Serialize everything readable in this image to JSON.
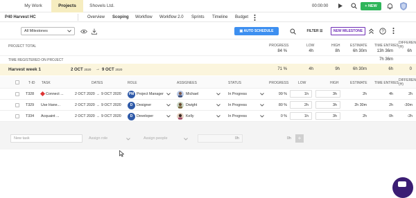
{
  "topbar": {
    "tabs": [
      "My Work",
      "Projects",
      "Shovels Ltd."
    ],
    "timer": "00:00:00",
    "new_label": "NEW"
  },
  "subbar": {
    "project": "P40 Harvest HC",
    "tabs": [
      "Overview",
      "Scoping",
      "Workflow",
      "Workflow 2.0",
      "Sprints",
      "Timeline",
      "Budget"
    ]
  },
  "toolbar": {
    "milestone_select": "All Milestones",
    "auto_schedule": "AUTO SCHEDULE",
    "filter": "FILTER",
    "new_milestone": "NEW MILESTONE"
  },
  "summary_headers": {
    "progress": "PROGRESS",
    "low": "LOW",
    "high": "HIGH",
    "estimate": "ESTIMATE",
    "time_entries": "TIME ENTRIES",
    "difference": "DIFFERENCE (H)"
  },
  "project_total": {
    "label": "PROJECT TOTAL",
    "progress": "84 %",
    "low": "4h",
    "high": "8h",
    "estimate": "6h 30m",
    "time_entries": "13h 36m",
    "difference": "6h"
  },
  "time_registered": {
    "label": "TIME REGISTERED ON PROJECT",
    "value": "7h 36m"
  },
  "milestone": {
    "name": "Harvest week 1",
    "start": "2 OCT",
    "start_year": "2020",
    "end": "9 OCT",
    "end_year": "2020",
    "progress": "71 %",
    "low": "4h",
    "high": "9h",
    "estimate": "6h 30m",
    "time_entries": "6h",
    "difference": "0"
  },
  "task_headers": {
    "id": "T-ID",
    "task": "TASK",
    "dates": "DATES",
    "role": "ROLE",
    "assignees": "ASSIGNEES",
    "status": "STATUS",
    "progress": "PROGRESS",
    "low": "LOW",
    "high": "HIGH",
    "estimate": "ESTIMATE",
    "time_entries": "TIME ENTRIES",
    "difference": "DIFFERENCE (H)"
  },
  "tasks": [
    {
      "id": "T328",
      "name": "Connect ...",
      "start": "2 OCT 2020",
      "end": "9 OCT 2020",
      "role": "Project Manager",
      "role_abbr": "PM",
      "assignee": "Michael",
      "status": "In Progress",
      "progress": "99 %",
      "low": "1h",
      "high": "3h",
      "estimate": "2h",
      "time_entries": "4h",
      "diff": "2h"
    },
    {
      "id": "T329",
      "name": "Use Hane...",
      "start": "2 OCT 2020",
      "end": "9 OCT 2020",
      "role": "Designer",
      "role_abbr": "D",
      "assignee": "Dwight",
      "status": "In Progress",
      "progress": "80 %",
      "low": "2h",
      "high": "3h",
      "estimate": "2h 30m",
      "time_entries": "2h",
      "diff": "-30m"
    },
    {
      "id": "T334",
      "name": "Acquaint ...",
      "start": "2 OCT 2020",
      "end": "9 OCT 2020",
      "role": "Developer",
      "role_abbr": "D",
      "assignee": "Kelly",
      "status": "In Progress",
      "progress": "0 %",
      "low": "1h",
      "high": "3h",
      "estimate": "2h",
      "time_entries": "0h",
      "diff": "-2h"
    }
  ],
  "new_task": {
    "task_placeholder": "New task",
    "role_placeholder": "Assign role",
    "people_placeholder": "Assign people",
    "estimate": "0h",
    "time": "0h"
  },
  "colors": {
    "accent_yellow": "#f6edc0",
    "new_green": "#2fb55a",
    "auto_blue": "#3d8ff0",
    "new_milestone_purple": "#6d2bb5",
    "milestone_row": "#fbf5dd"
  }
}
